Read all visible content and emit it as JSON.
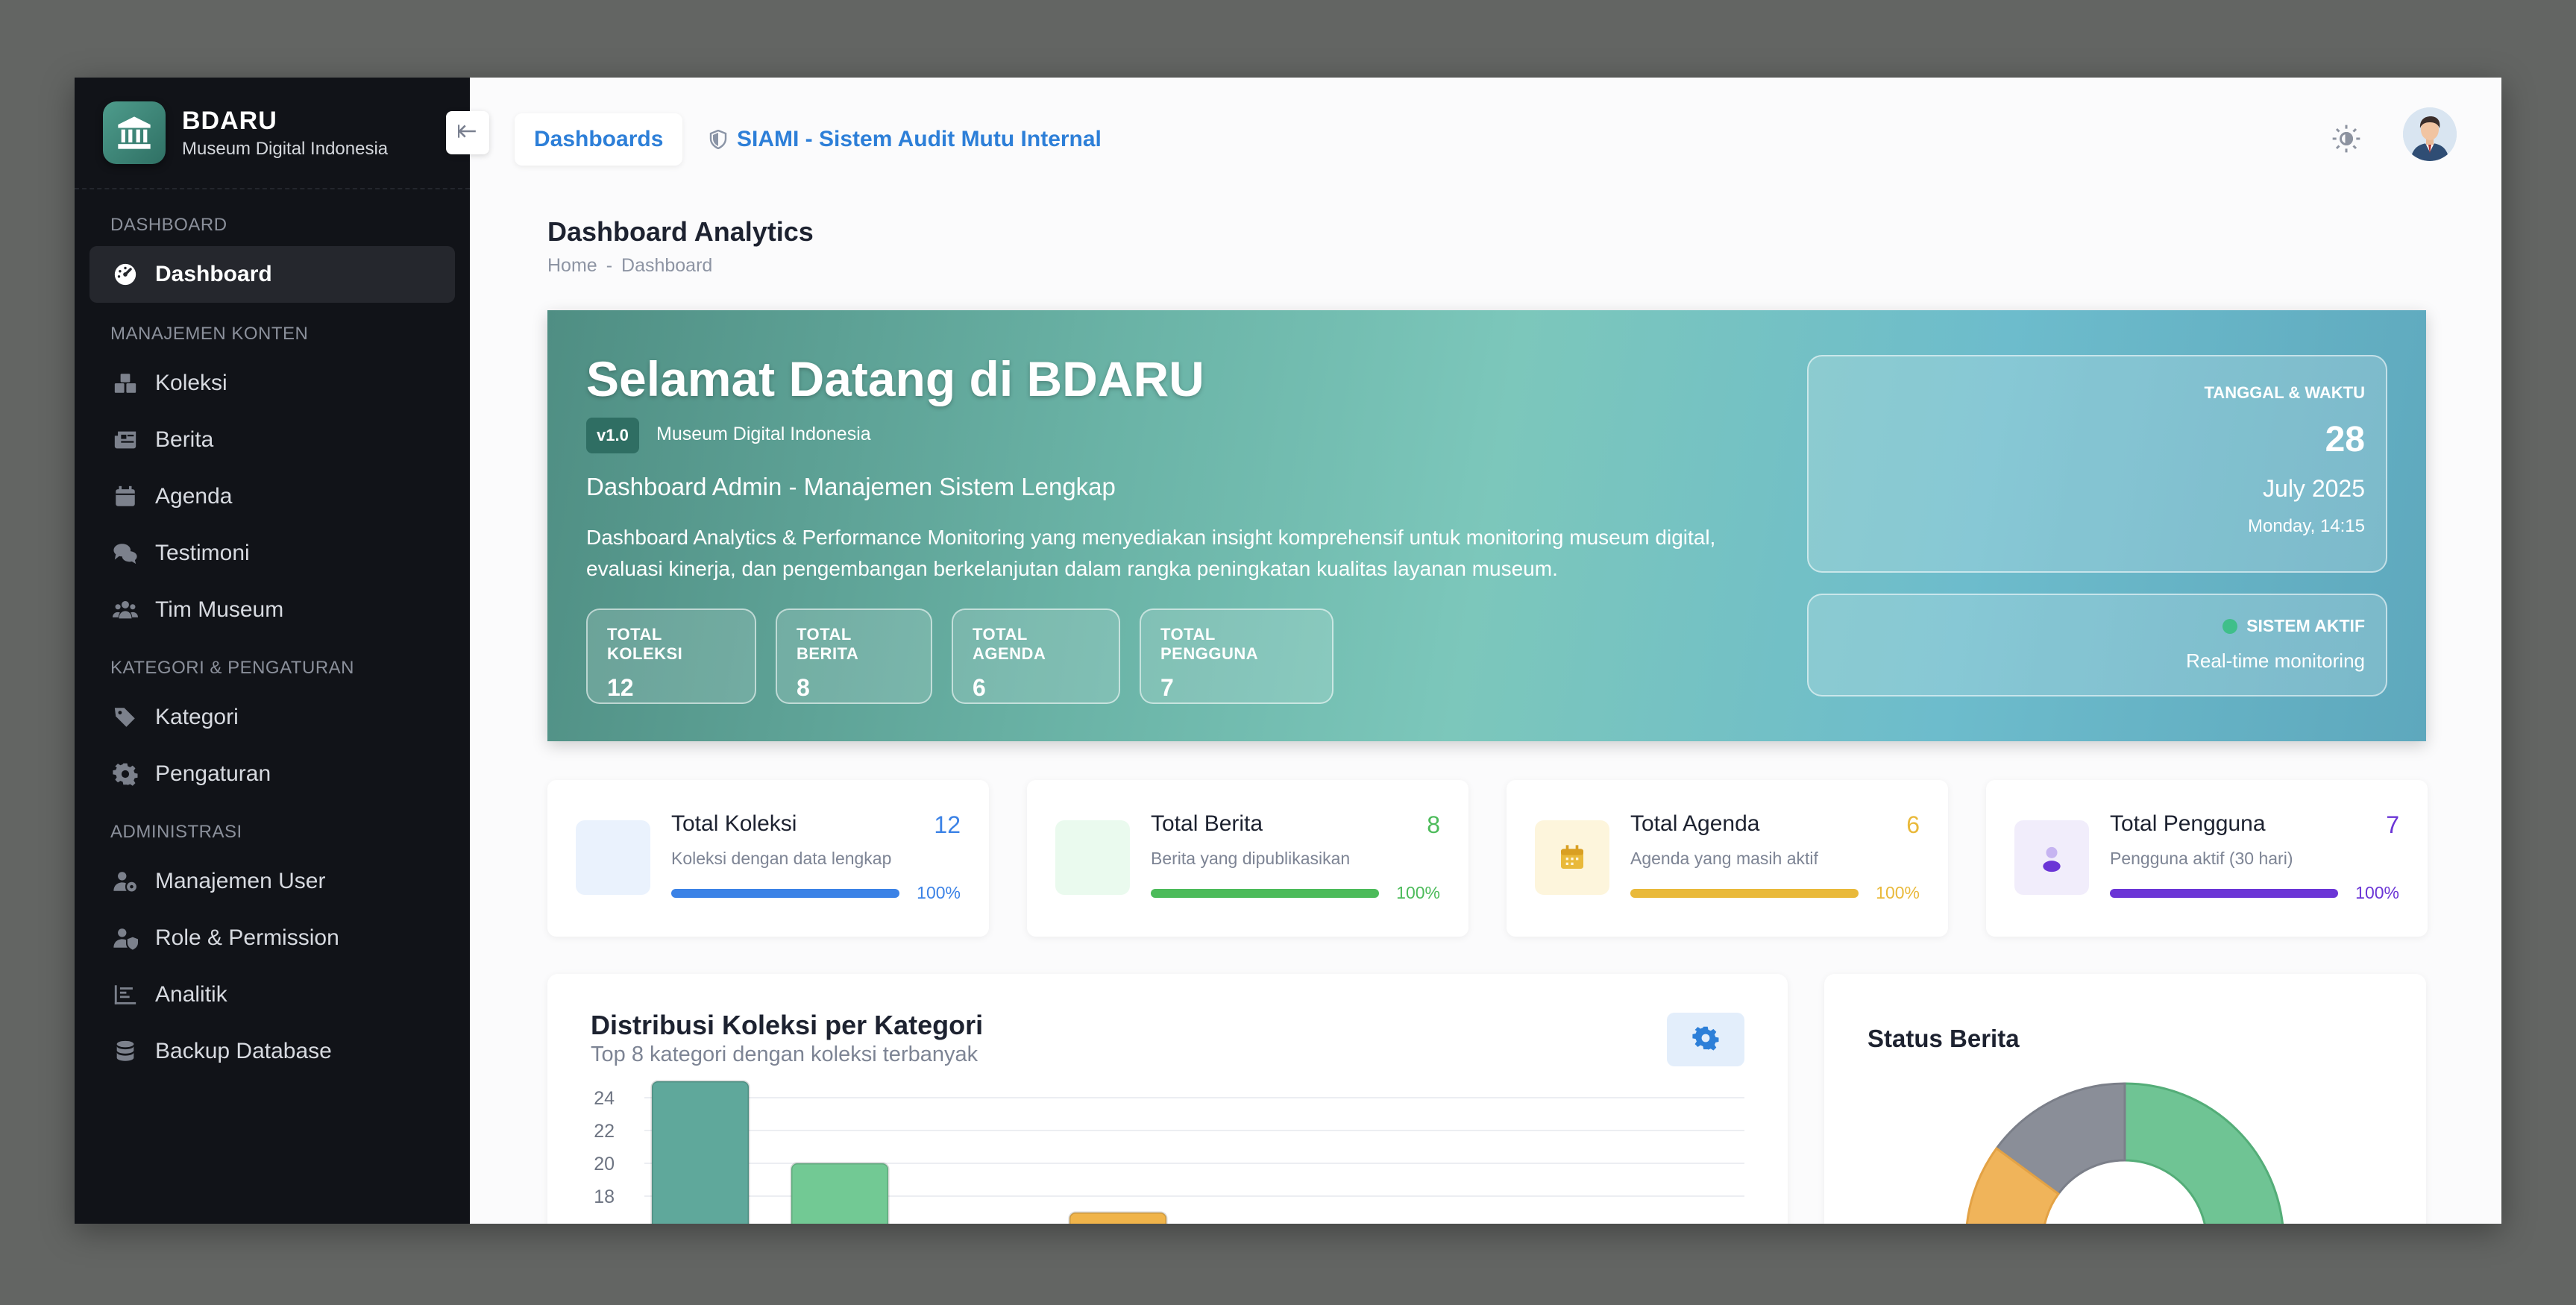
{
  "brand": {
    "name": "BDARU",
    "subtitle": "Museum Digital Indonesia"
  },
  "sidebar": {
    "sections": [
      {
        "title": "DASHBOARD",
        "items": [
          {
            "label": "Dashboard",
            "icon": "gauge-icon",
            "active": true
          }
        ]
      },
      {
        "title": "MANAJEMEN KONTEN",
        "items": [
          {
            "label": "Koleksi",
            "icon": "boxes-icon"
          },
          {
            "label": "Berita",
            "icon": "newspaper-icon"
          },
          {
            "label": "Agenda",
            "icon": "calendar-icon"
          },
          {
            "label": "Testimoni",
            "icon": "comments-icon"
          },
          {
            "label": "Tim Museum",
            "icon": "users-icon"
          }
        ]
      },
      {
        "title": "KATEGORI & PENGATURAN",
        "items": [
          {
            "label": "Kategori",
            "icon": "tags-icon"
          },
          {
            "label": "Pengaturan",
            "icon": "gear-icon"
          }
        ]
      },
      {
        "title": "ADMINISTRASI",
        "items": [
          {
            "label": "Manajemen User",
            "icon": "user-gear-icon"
          },
          {
            "label": "Role & Permission",
            "icon": "user-shield-icon"
          },
          {
            "label": "Analitik",
            "icon": "chart-line-icon"
          },
          {
            "label": "Backup Database",
            "icon": "database-icon"
          }
        ]
      }
    ]
  },
  "topbar": {
    "tab_dashboards": "Dashboards",
    "tab_siami": "SIAMI - Sistem Audit Mutu Internal"
  },
  "page": {
    "title": "Dashboard Analytics",
    "breadcrumb": [
      "Home",
      "-",
      "Dashboard"
    ]
  },
  "hero": {
    "title": "Selamat Datang di BDARU",
    "version": "v1.0",
    "org": "Museum Digital Indonesia",
    "subtitle": "Dashboard Admin - Manajemen Sistem Lengkap",
    "description": "Dashboard Analytics & Performance Monitoring yang menyediakan insight komprehensif untuk monitoring museum digital, evaluasi kinerja, dan pengembangan berkelanjutan dalam rangka peningkatan kualitas layanan museum.",
    "stats": [
      {
        "label": "TOTAL KOLEKSI",
        "value": "12"
      },
      {
        "label": "TOTAL BERITA",
        "value": "8"
      },
      {
        "label": "TOTAL AGENDA",
        "value": "6"
      },
      {
        "label": "TOTAL PENGGUNA",
        "value": "7"
      }
    ],
    "datetime": {
      "label": "TANGGAL & WAKTU",
      "day": "28",
      "month_year": "July 2025",
      "weekday_time": "Monday, 14:15"
    },
    "system": {
      "status": "SISTEM AKTIF",
      "monitoring": "Real-time monitoring"
    }
  },
  "cards": [
    {
      "title": "Total Koleksi",
      "value": "12",
      "desc": "Koleksi dengan data lengkap",
      "percent": "100%",
      "color": "#3b82e6",
      "bg": "#eaf2fd"
    },
    {
      "title": "Total Berita",
      "value": "8",
      "desc": "Berita yang dipublikasikan",
      "percent": "100%",
      "color": "#4cbb5a",
      "bg": "#eafaee"
    },
    {
      "title": "Total Agenda",
      "value": "6",
      "desc": "Agenda yang masih aktif",
      "percent": "100%",
      "color": "#e9b93a",
      "bg": "#fdf5dc"
    },
    {
      "title": "Total Pengguna",
      "value": "7",
      "desc": "Pengguna aktif (30 hari)",
      "percent": "100%",
      "color": "#6b35d6",
      "bg": "#f1edfb"
    }
  ],
  "chart": {
    "title": "Distribusi Koleksi per Kategori",
    "subtitle": "Top 8 kategori dengan koleksi terbanyak",
    "y_ticks": [
      "24",
      "22",
      "20",
      "18"
    ]
  },
  "chart_data": {
    "type": "bar",
    "categories": [
      "",
      "",
      "",
      ""
    ],
    "values": [
      25,
      20,
      null,
      17
    ],
    "ylim": [
      18,
      24
    ],
    "colors": [
      "#5fa89b",
      "#72c994",
      "#f0b44a",
      "#f0b44a"
    ]
  },
  "status_berita": {
    "title": "Status Berita"
  },
  "colors": {
    "accent": "#2d7fd8",
    "sidebar_bg": "#111318",
    "hero_teal": "#6ab3a6"
  }
}
